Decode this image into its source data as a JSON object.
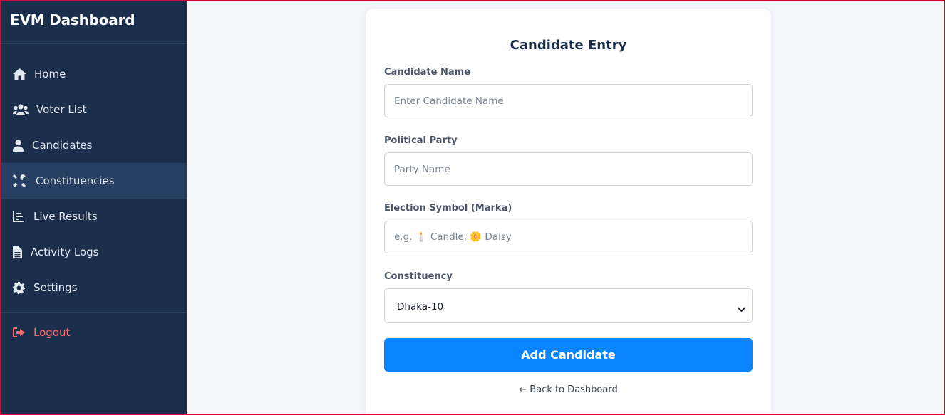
{
  "app": {
    "title": "EVM Dashboard"
  },
  "sidebar": {
    "items": [
      {
        "label": "Home",
        "icon": "home-icon"
      },
      {
        "label": "Voter List",
        "icon": "users-icon"
      },
      {
        "label": "Candidates",
        "icon": "user-tie-icon"
      },
      {
        "label": "Constituencies",
        "icon": "tools-icon",
        "active": true
      },
      {
        "label": "Live Results",
        "icon": "chart-icon"
      },
      {
        "label": "Activity Logs",
        "icon": "file-icon"
      },
      {
        "label": "Settings",
        "icon": "gear-icon"
      }
    ],
    "logout": {
      "label": "Logout",
      "icon": "sign-out-icon",
      "color": "#ff6b6b"
    }
  },
  "form": {
    "title": "Candidate Entry",
    "candidate_name": {
      "label": "Candidate Name",
      "placeholder": "Enter Candidate Name",
      "value": ""
    },
    "party": {
      "label": "Political Party",
      "placeholder": "Party Name",
      "value": ""
    },
    "symbol": {
      "label": "Election Symbol (Marka)",
      "placeholder": "e.g. 🕯️ Candle, 🌼 Daisy",
      "value": ""
    },
    "constituency": {
      "label": "Constituency",
      "selected": "Dhaka-10"
    },
    "submit_label": "Add Candidate",
    "back_link": "← Back to Dashboard"
  },
  "colors": {
    "sidebar_bg": "#1b2e4b",
    "sidebar_active": "#263f62",
    "accent": "#0a84ff",
    "page_bg": "#f4f6fa",
    "logout": "#ff6b6b"
  }
}
